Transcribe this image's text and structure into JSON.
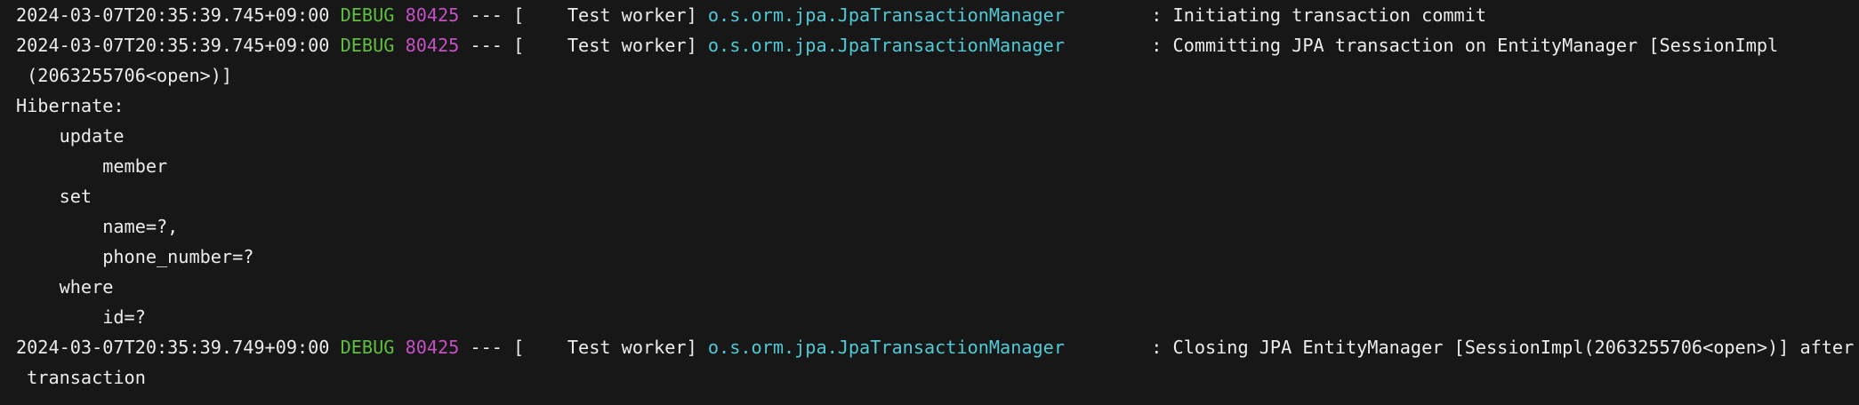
{
  "colors": {
    "background": "#171717",
    "text": "#ececec",
    "debug_level": "#5fbf3f",
    "pid": "#c64fc6",
    "logger": "#4ec9d6"
  },
  "log": {
    "entries": [
      {
        "timestamp": "2024-03-07T20:35:39.745+09:00",
        "level": "DEBUG",
        "pid": "80425",
        "separator": "--- [",
        "thread": "    Test worker]",
        "logger": "o.s.orm.jpa.JpaTransactionManager",
        "message": ": Initiating transaction commit"
      },
      {
        "timestamp": "2024-03-07T20:35:39.745+09:00",
        "level": "DEBUG",
        "pid": "80425",
        "separator": "--- [",
        "thread": "    Test worker]",
        "logger": "o.s.orm.jpa.JpaTransactionManager",
        "message": ": Committing JPA transaction on EntityManager [SessionImpl",
        "continuation": " (2063255706<open>)]"
      }
    ],
    "sql_lines": [
      "Hibernate: ",
      "    update",
      "        member ",
      "    set",
      "        name=?,",
      "        phone_number=? ",
      "    where",
      "        id=?"
    ],
    "last_entry": {
      "timestamp": "2024-03-07T20:35:39.749+09:00",
      "level": "DEBUG",
      "pid": "80425",
      "separator": "--- [",
      "thread": "    Test worker]",
      "logger": "o.s.orm.jpa.JpaTransactionManager",
      "message": ": Closing JPA EntityManager [SessionImpl(2063255706<open>)] after",
      "continuation": " transaction"
    }
  }
}
